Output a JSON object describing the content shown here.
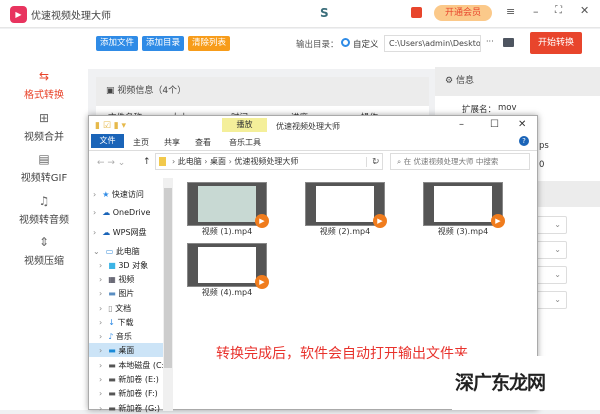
{
  "app": {
    "title": "优速视频处理大师",
    "vip_label": "开通会员"
  },
  "sidebar": {
    "items": [
      {
        "label": "格式转换",
        "active": true
      },
      {
        "label": "视频合并"
      },
      {
        "label": "视频转GIF"
      },
      {
        "label": "视频转音频"
      },
      {
        "label": "视频压缩"
      }
    ]
  },
  "toolbar": {
    "add_file": "添加文件",
    "add_dir": "添加目录",
    "clear_list": "清除列表",
    "output_label": "输出目录：",
    "radio_label": "自定义",
    "output_path": "C:\\Users\\admin\\Deskto",
    "more": "···",
    "start": "开始转换"
  },
  "video_panel": {
    "title": "视频信息（4个）",
    "columns": [
      "文件名称",
      "大小",
      "时间",
      "进度",
      "操作"
    ]
  },
  "info_panel": {
    "title": "信息",
    "ext_label": "扩展名：",
    "ext_value": "mov",
    "partial1": "ps",
    "partial2": "0"
  },
  "explorer": {
    "title": "优速视频处理大师",
    "context_tab": "播放",
    "tabs": [
      "文件",
      "主页",
      "共享",
      "查看",
      "音乐工具"
    ],
    "breadcrumb": [
      "此电脑",
      "桌面",
      "优速视频处理大师"
    ],
    "search_placeholder": "在 优速视频处理大师 中搜索",
    "nav": [
      "快速访问",
      "OneDrive",
      "WPS网盘",
      "此电脑",
      "3D 对象",
      "视频",
      "图片",
      "文档",
      "下载",
      "音乐",
      "桌面",
      "本地磁盘 (C:",
      "新加卷 (E:)",
      "新加卷 (F:)",
      "新加卷 (G:)"
    ],
    "files": [
      "视频 (1).mp4",
      "视频 (2).mp4",
      "视频 (3).mp4",
      "视频 (4).mp4"
    ]
  },
  "annotation": "转换完成后，软件会自动打开输出文件夹",
  "watermark": "深广东龙网",
  "colors": {
    "accent": "#e8452c",
    "blue": "#2f8be6",
    "orange": "#f79c1a"
  }
}
